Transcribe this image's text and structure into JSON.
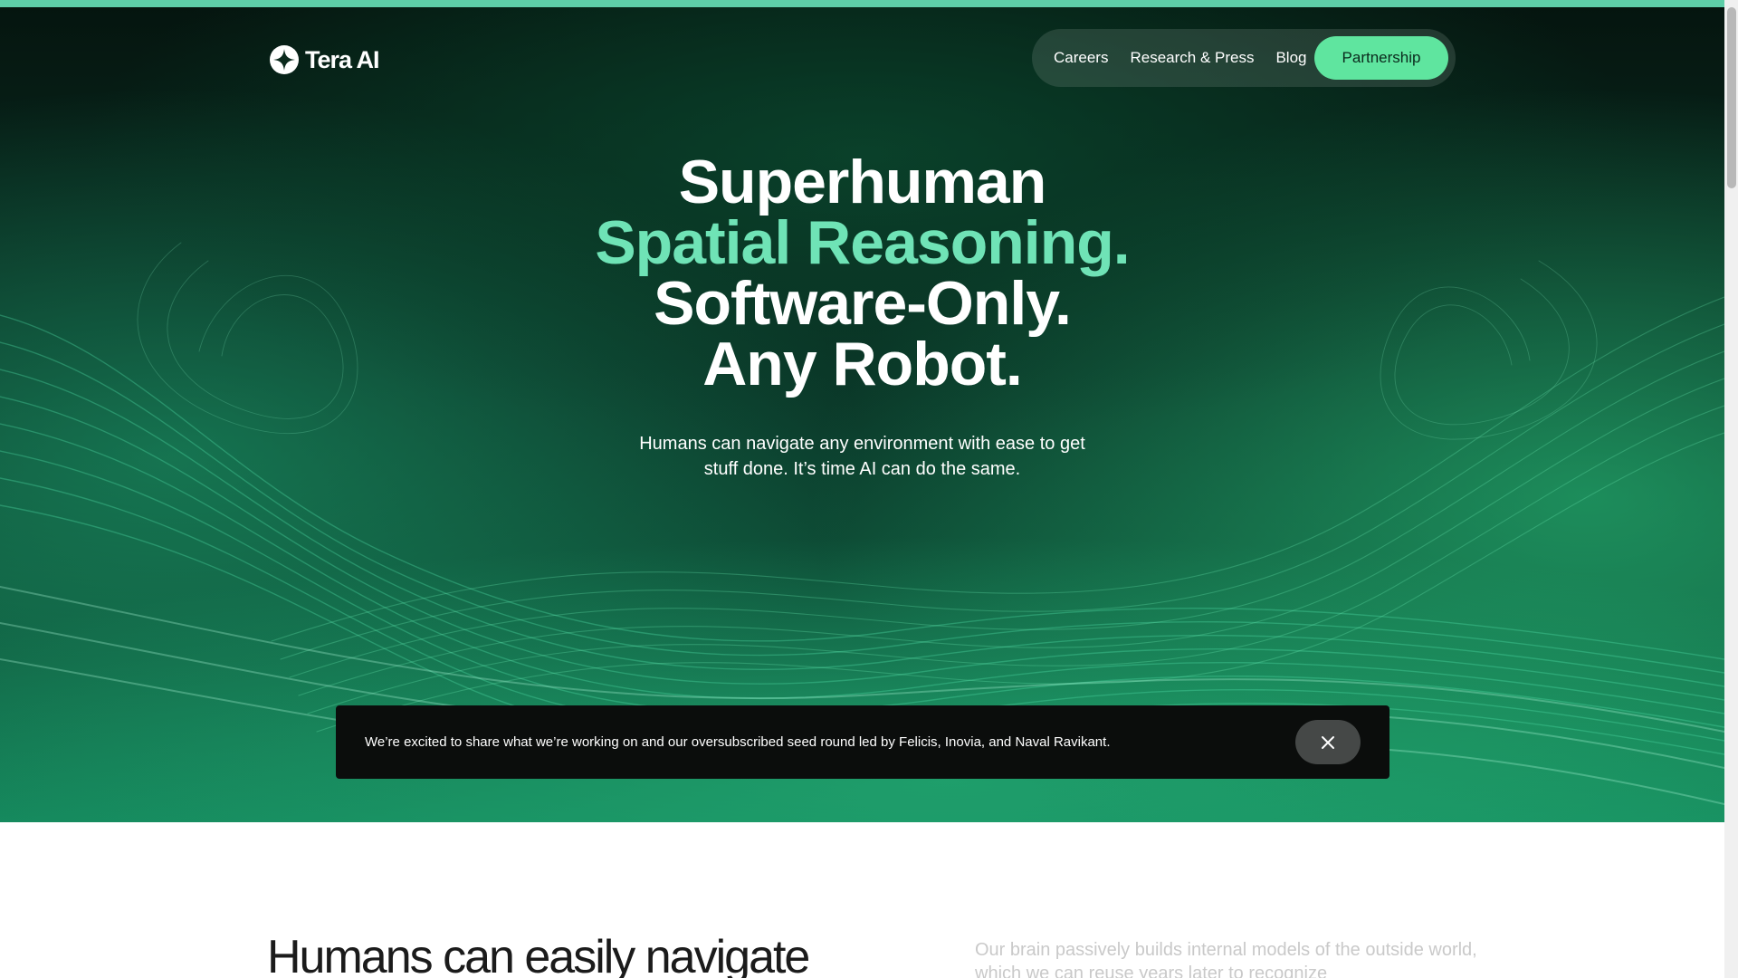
{
  "brand": {
    "name": "Tera AI",
    "accent_color": "#5fe59f",
    "headline_accent_color": "#6fe3b6",
    "strip_color": "#5ecea8"
  },
  "nav": {
    "links": [
      "Careers",
      "Research & Press",
      "Blog"
    ],
    "cta_label": "Partnership"
  },
  "hero": {
    "headline_lines": [
      "Superhuman",
      "Spatial Reasoning.",
      "Software-Only.",
      "Any Robot."
    ],
    "subtext_lines": [
      "Humans can navigate any environment with ease to get",
      "stuff done. It’s time AI can do the same."
    ]
  },
  "announcement": {
    "text": "We’re excited to share what we’re working on and our oversubscribed seed round led by Felicis, Inovia, and Naval Ravikant.",
    "close_icon": "close-icon"
  },
  "section": {
    "heading": "Humans can easily navigate",
    "paragraph": "Our brain passively builds internal models of the outside world, which we can reuse years later to recognize"
  }
}
